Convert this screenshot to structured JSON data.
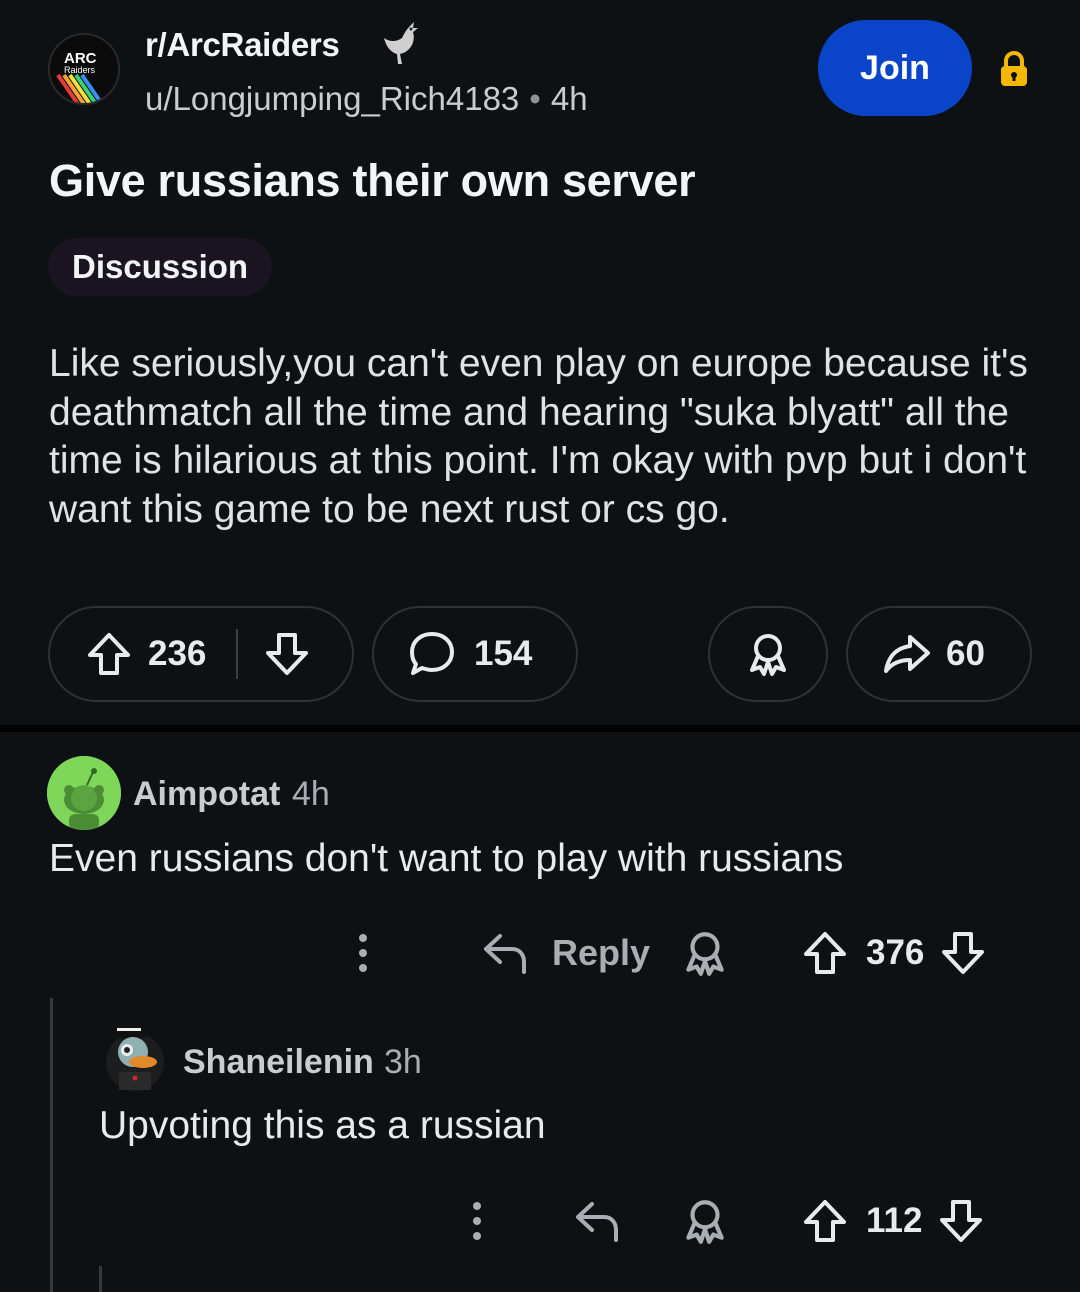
{
  "post": {
    "subreddit": "r/ArcRaiders",
    "subreddit_logo_text": "ARC Raiders",
    "author": "u/Longjumping_Rich4183",
    "separator": "•",
    "time": "4h",
    "join_label": "Join",
    "title": "Give russians their own server",
    "flair": "Discussion",
    "body": "Like seriously,you can't even play on europe because it's deathmatch all the time and hearing \"suka blyatt\" all the time is hilarious at this point. I'm okay with pvp but i don't want this game to be next rust or cs go.",
    "upvotes": "236",
    "comments": "154",
    "shares": "60"
  },
  "comments": [
    {
      "user": "Aimpotat",
      "time": "4h",
      "text": "Even russians don't want to play with russians",
      "reply_label": "Reply",
      "votes": "376"
    },
    {
      "user": "Shaneilenin",
      "time": "3h",
      "text": "Upvoting this as a russian",
      "votes": "112"
    }
  ],
  "colors": {
    "background": "#0e1113",
    "join_button": "#0a45c9",
    "lock": "#f5b700",
    "avatar_green": "#7fd75a"
  },
  "icons": [
    "upvote-icon",
    "downvote-icon",
    "comment-icon",
    "award-icon",
    "share-icon",
    "lock-icon",
    "reply-icon",
    "more-icon",
    "rooster-flair-icon"
  ]
}
